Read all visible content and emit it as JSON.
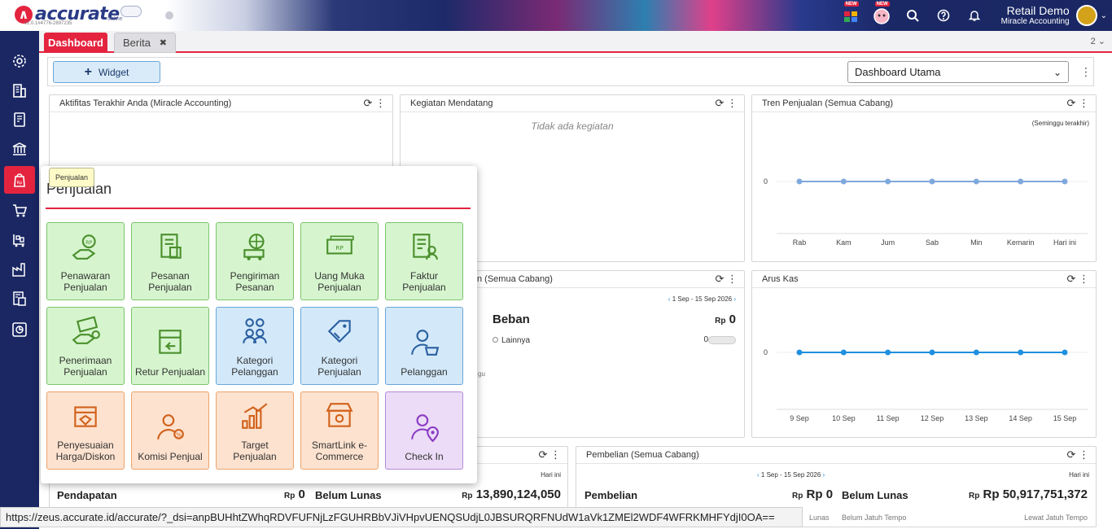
{
  "app": {
    "logo_text": "accurate",
    "logo_sub": "online",
    "version": "v1.0.1#4776-2897235",
    "user_name": "Retail Demo",
    "company": "Miracle Accounting",
    "new_badge": "NEW"
  },
  "tabs": {
    "dashboard": "Dashboard",
    "berita": "Berita",
    "close": "✖",
    "count": "2"
  },
  "toolbar": {
    "widget_label": "Widget",
    "dashboard_select": "Dashboard Utama"
  },
  "widgets": {
    "aktifitas": {
      "title": "Aktifitas Terakhir Anda (Miracle Accounting)"
    },
    "kegiatan": {
      "title": "Kegiatan Mendatang",
      "empty": "Tidak ada kegiatan"
    },
    "tren": {
      "title": "Tren Penjualan (Semua Cabang)",
      "period": "(Seminggu terakhir)",
      "zero": "0"
    },
    "laba": {
      "title_tail": "n (Semua Cabang)",
      "date_range": "1 Sep - 15 Sep 2026",
      "beban_label": "Beban",
      "beban_value": "0",
      "currency": "Rp",
      "lainnya_label": "Lainnya",
      "lainnya_value": "0",
      "fragment": "gu"
    },
    "arus": {
      "title": "Arus Kas",
      "zero": "0"
    },
    "penjualan": {
      "today": "Hari ini",
      "pendapatan_label": "Pendapatan",
      "pendapatan_value": "0",
      "belum_lunas_label": "Belum Lunas",
      "belum_lunas_value": "13,890,124,050",
      "currency": "Rp"
    },
    "pembelian": {
      "title": "Pembelian (Semua Cabang)",
      "date_range": "1 Sep - 15 Sep 2026",
      "today": "Hari ini",
      "pembelian_label": "Pembelian",
      "pembelian_value": "0",
      "belum_lunas_label": "Belum Lunas",
      "belum_lunas_value": "50,917,751,372",
      "currency": "Rp",
      "lunas": "Lunas",
      "jatuh_tempo": "Belum Jatuh Tempo",
      "lewat": "Lewat Jatuh Tempo"
    }
  },
  "popup": {
    "title": "Penjualan",
    "tooltip": "Penjualan",
    "tiles": [
      {
        "label1": "Penawaran",
        "label2": "Penjualan",
        "icon": "hand-coin-icon",
        "color": "green"
      },
      {
        "label1": "Pesanan",
        "label2": "Penjualan",
        "icon": "order-doc-icon",
        "color": "green"
      },
      {
        "label1": "Pengiriman",
        "label2": "Pesanan",
        "icon": "truck-globe-icon",
        "color": "green"
      },
      {
        "label1": "Uang Muka",
        "label2": "Penjualan",
        "icon": "cash-icon",
        "color": "green"
      },
      {
        "label1": "Faktur",
        "label2": "Penjualan",
        "icon": "invoice-user-icon",
        "color": "green"
      },
      {
        "label1": "Penerimaan",
        "label2": "Penjualan",
        "icon": "money-hand-icon",
        "color": "green"
      },
      {
        "label1": "Retur Penjualan",
        "label2": "",
        "icon": "return-box-icon",
        "color": "green"
      },
      {
        "label1": "Kategori",
        "label2": "Pelanggan",
        "icon": "customer-group-icon",
        "color": "blue"
      },
      {
        "label1": "Kategori",
        "label2": "Penjualan",
        "icon": "tag-icon",
        "color": "blue"
      },
      {
        "label1": "Pelanggan",
        "label2": "",
        "icon": "customer-basket-icon",
        "color": "blue"
      },
      {
        "label1": "Penyesuaian",
        "label2": "Harga/Diskon",
        "icon": "price-box-icon",
        "color": "orange"
      },
      {
        "label1": "Komisi Penjual",
        "label2": "",
        "icon": "commission-user-icon",
        "color": "orange"
      },
      {
        "label1": "Target",
        "label2": "Penjualan",
        "icon": "target-chart-icon",
        "color": "orange"
      },
      {
        "label1": "SmartLink e-",
        "label2": "Commerce",
        "icon": "store-icon",
        "color": "orange"
      },
      {
        "label1": "Check In",
        "label2": "",
        "icon": "user-pin-icon",
        "color": "purple"
      }
    ]
  },
  "colors": {
    "accent": "#e4243f",
    "nav": "#1a2763",
    "line_tren": "#7fa9dc",
    "line_arus": "#1f8fe0"
  },
  "chart_data": [
    {
      "type": "line",
      "title": "Tren Penjualan (Semua Cabang)",
      "categories": [
        "Rab",
        "Kam",
        "Jum",
        "Sab",
        "Min",
        "Kemarin",
        "Hari ini"
      ],
      "series": [
        {
          "values": [
            0,
            0,
            0,
            0,
            0,
            0,
            0
          ]
        }
      ],
      "ylabel": "",
      "grid": true
    },
    {
      "type": "line",
      "title": "Arus Kas",
      "categories": [
        "9 Sep",
        "10 Sep",
        "11 Sep",
        "12 Sep",
        "13 Sep",
        "14 Sep",
        "15 Sep"
      ],
      "series": [
        {
          "values": [
            0,
            0,
            0,
            0,
            0,
            0,
            0
          ]
        }
      ],
      "ylabel": "",
      "grid": true
    }
  ],
  "status_url": "https://zeus.accurate.id/accurate/?_dsi=anpBUHhtZWhqRDVFUFNjLzFGUHRBbVJiVHpvUENQSUdjL0JBSURQRFNUdW1aVk1ZMEl2WDF4WFRKMHFYdjI0OA=="
}
